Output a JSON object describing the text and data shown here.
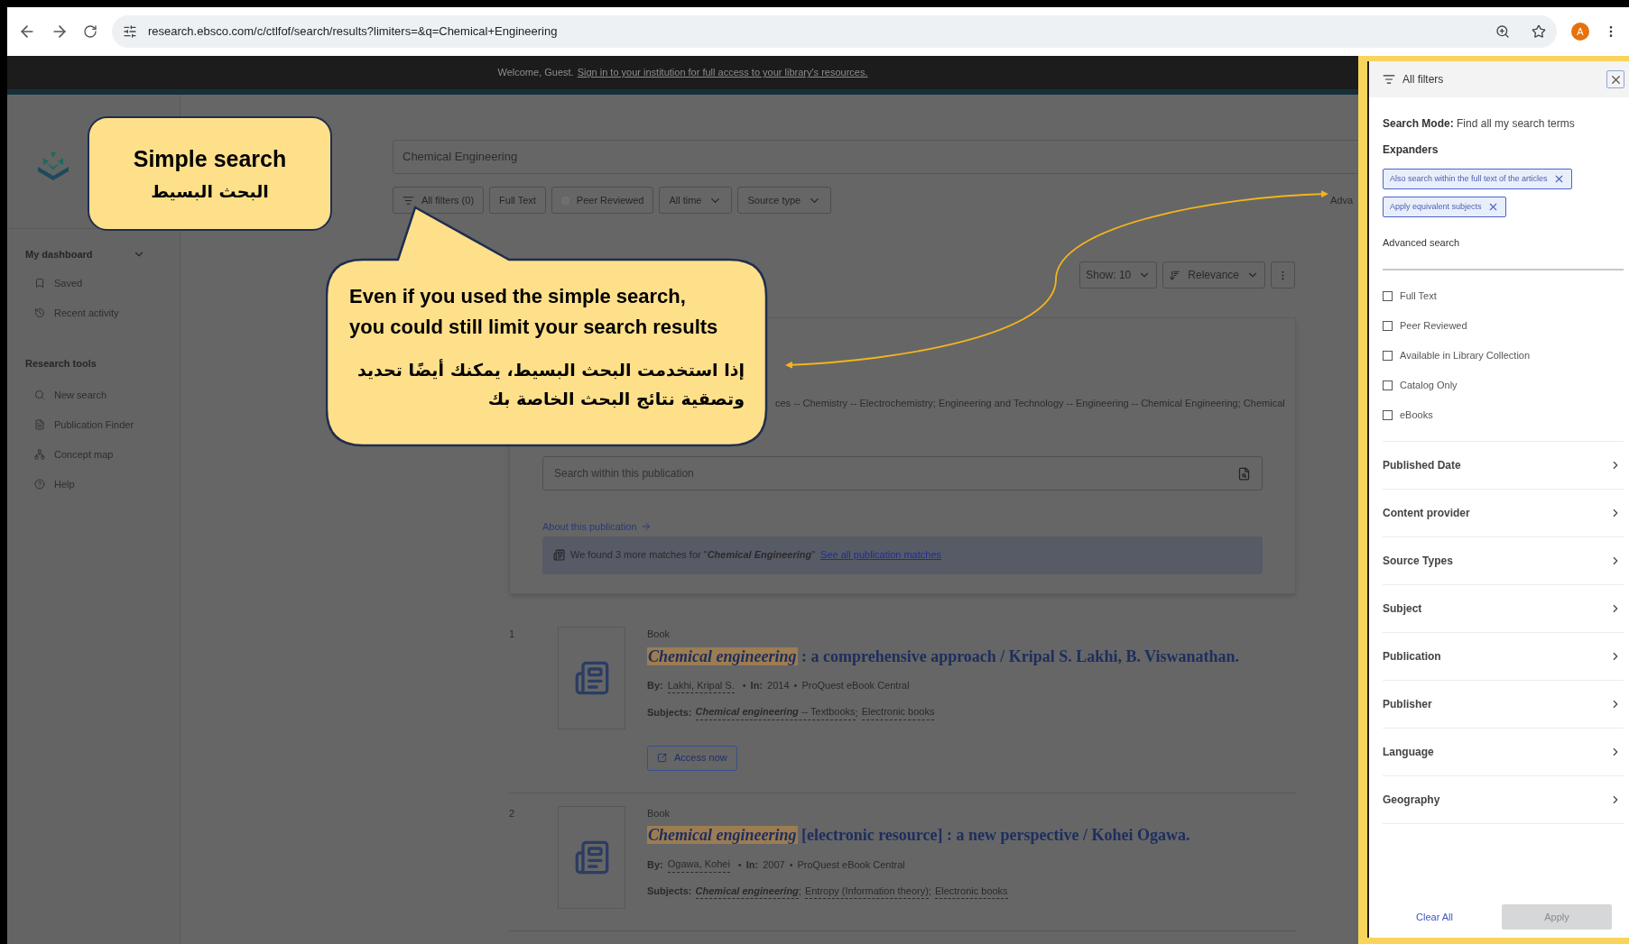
{
  "browser": {
    "url": "research.ebsco.com/c/ctlfof/search/results?limiters=&q=Chemical+Engineering",
    "avatar": "A"
  },
  "banner": {
    "text": "Welcome, Guest.",
    "link": "Sign in to your institution for full access to your library's resources."
  },
  "sidebar": {
    "sections": [
      {
        "title": "My dashboard",
        "expanded": true,
        "items": [
          "Saved",
          "Recent activity"
        ]
      },
      {
        "title": "Research tools",
        "items": [
          "New search",
          "Publication Finder",
          "Concept map",
          "Help"
        ]
      }
    ]
  },
  "search": {
    "value": "Chemical Engineering"
  },
  "filters": [
    {
      "label": "All filters (0)",
      "kind": "filter"
    },
    {
      "label": "Full Text",
      "kind": "plain"
    },
    {
      "label": "Peer Reviewed",
      "kind": "dot"
    },
    {
      "label": "All time",
      "kind": "dropdown"
    },
    {
      "label": "Source type",
      "kind": "dropdown"
    }
  ],
  "advanced_link": "Adva",
  "results_toolbar": {
    "show": "Show: 10",
    "sort": "Relevance"
  },
  "publication": {
    "subjects": "ces -- Chemistry -- Electrochemistry; Engineering and Technology -- Engineering -- Chemical Engineering; Chemical",
    "search_placeholder": "Search within this publication",
    "about_link": "About this publication",
    "matches": "We found 3 more matches for \"**Chemical Engineering**\"",
    "matches_link": "See all publication matches"
  },
  "results": [
    {
      "number": "1",
      "type": "Book",
      "title_highlight": "Chemical engineering",
      "title_rest": ": a comprehensive approach / Kripal S. Lakhi, B. Viswanathan.",
      "by_label": "By:",
      "authors": [
        "Lakhi, Kripal S."
      ],
      "bullet": "•",
      "separator": ";",
      "in_label": "In:",
      "year": "2014",
      "source": "ProQuest eBook Central",
      "subjects_label": "Subjects:",
      "subjects": [
        "**Chemical engineering** -- Textbooks",
        "Electronic books"
      ],
      "button": "Access now"
    },
    {
      "number": "2",
      "type": "Book",
      "title_highlight": "Chemical engineering",
      "title_rest": "[electronic resource] : a new perspective / Kohei Ogawa.",
      "by_label": "By:",
      "authors": [
        "Ogawa, Kohei"
      ],
      "bullet": "•",
      "separator": ";",
      "in_label": "In:",
      "year": "2007",
      "source": "ProQuest eBook Central",
      "subjects_label": "Subjects:",
      "subjects": [
        "**Chemical engineering**",
        "Entropy (Information theory)",
        "Electronic books"
      ]
    }
  ],
  "callouts": [
    {
      "lines": [
        "Simple search"
      ],
      "arabic": [
        "البحث البسيط"
      ]
    },
    {
      "lines": [
        "Even if you used the simple search,",
        "you could still limit your search results"
      ],
      "arabic": [
        "إذا استخدمت البحث البسيط، يمكنك أيضًا تحديد",
        "وتصقية نتائج البحث الخاصة بك"
      ]
    }
  ],
  "panel": {
    "title": "All filters",
    "search_mode_label": "Search Mode:",
    "search_mode": "Find all my search terms",
    "expanders_title": "Expanders",
    "expanders": [
      "Also search within the full text of the articles",
      "Apply equivalent subjects"
    ],
    "advanced_title": "Advanced search",
    "limiters": [
      {
        "label": "Full Text",
        "checked": false
      },
      {
        "label": "Peer Reviewed",
        "checked": false
      },
      {
        "label": "Available in Library Collection",
        "checked": false
      },
      {
        "label": "Catalog Only",
        "checked": false
      },
      {
        "label": "eBooks",
        "checked": false
      }
    ],
    "facets": [
      "Published Date",
      "Content provider",
      "Source Types",
      "Subject",
      "Publication",
      "Publisher",
      "Language",
      "Geography"
    ],
    "clear": "Clear All",
    "apply": "Apply",
    "apply_disabled": true
  }
}
